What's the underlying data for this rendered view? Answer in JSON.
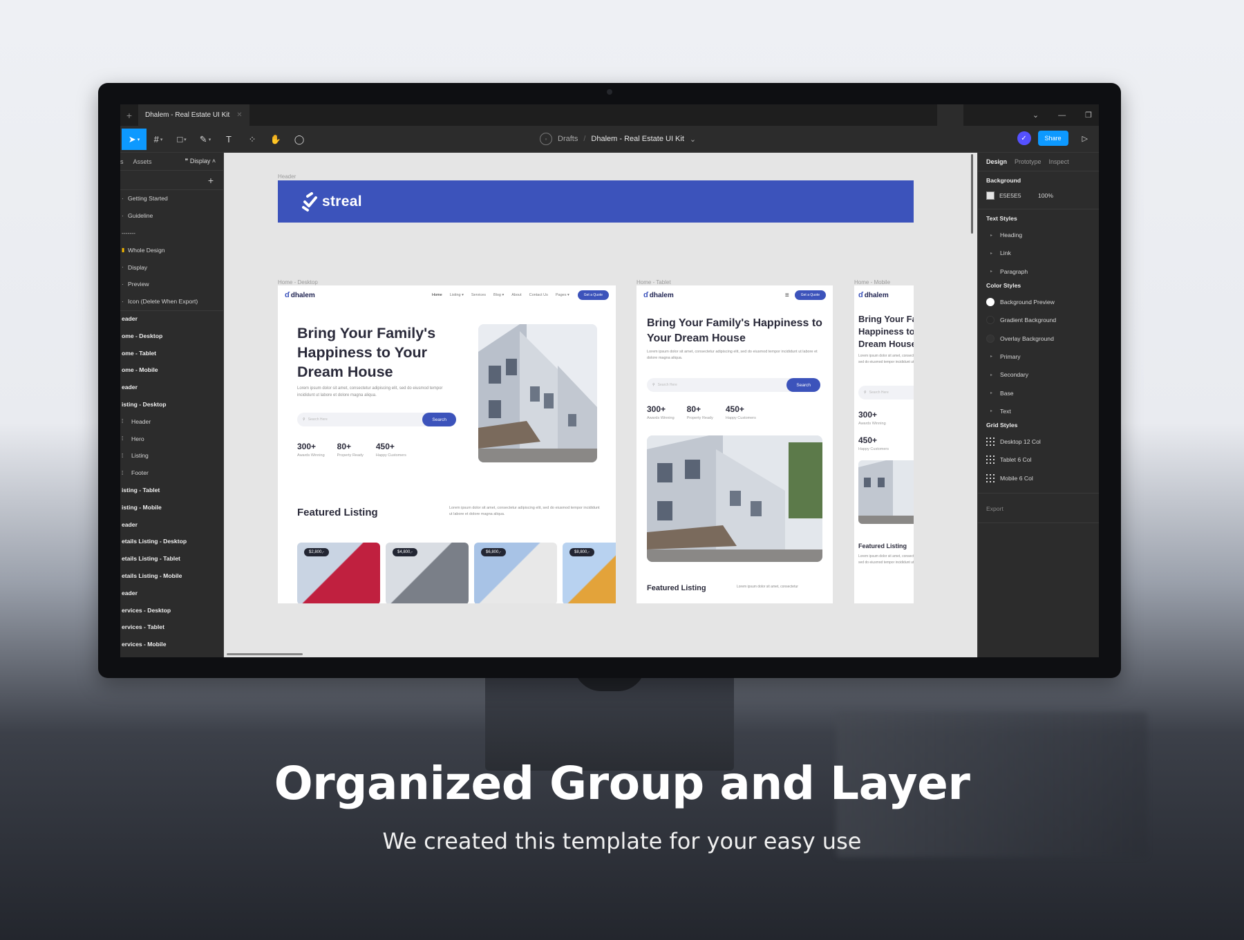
{
  "window": {
    "tab_title": "Dhalem - Real Estate UI Kit"
  },
  "toolbar": {
    "crumb_root": "Drafts",
    "crumb_sep": "/",
    "file_name": "Dhalem - Real Estate UI Kit",
    "share": "Share"
  },
  "left_panel": {
    "tabs": [
      "s",
      "Assets",
      "Display"
    ],
    "layers": [
      {
        "label": "Getting Started",
        "icon": "·",
        "bold": false
      },
      {
        "label": "Guideline",
        "icon": "·",
        "bold": false
      },
      {
        "label": "-------",
        "icon": "",
        "bold": false
      },
      {
        "label": "Whole Design",
        "icon": "▮",
        "bold": false
      },
      {
        "label": "Display",
        "icon": "·",
        "bold": false
      },
      {
        "label": "Preview",
        "icon": "·",
        "bold": false
      },
      {
        "label": "Icon (Delete When Export)",
        "icon": "·",
        "bold": false
      },
      {
        "label": "eader",
        "icon": "",
        "bold": true
      },
      {
        "label": "ome - Desktop",
        "icon": "",
        "bold": true
      },
      {
        "label": "ome - Tablet",
        "icon": "",
        "bold": true
      },
      {
        "label": "ome - Mobile",
        "icon": "",
        "bold": true
      },
      {
        "label": "eader",
        "icon": "",
        "bold": true
      },
      {
        "label": "isting - Desktop",
        "icon": "",
        "bold": true
      },
      {
        "label": "Header",
        "icon": "",
        "bold": false,
        "indent": true
      },
      {
        "label": "Hero",
        "icon": "",
        "bold": false,
        "indent": true
      },
      {
        "label": "Listing",
        "icon": "",
        "bold": false,
        "indent": true
      },
      {
        "label": "Footer",
        "icon": "",
        "bold": false,
        "indent": true
      },
      {
        "label": "isting - Tablet",
        "icon": "",
        "bold": true
      },
      {
        "label": "isting - Mobile",
        "icon": "",
        "bold": true
      },
      {
        "label": "eader",
        "icon": "",
        "bold": true
      },
      {
        "label": "etails Listing - Desktop",
        "icon": "",
        "bold": true
      },
      {
        "label": "etails Listing - Tablet",
        "icon": "",
        "bold": true
      },
      {
        "label": "etails Listing - Mobile",
        "icon": "",
        "bold": true
      },
      {
        "label": "eader",
        "icon": "",
        "bold": true
      },
      {
        "label": "ervices - Desktop",
        "icon": "",
        "bold": true
      },
      {
        "label": "ervices - Tablet",
        "icon": "",
        "bold": true
      },
      {
        "label": "ervices - Mobile",
        "icon": "",
        "bold": true
      }
    ]
  },
  "canvas": {
    "header_label": "Header",
    "brand": "streal",
    "desktop": {
      "frame_label": "Home - Desktop",
      "brand": "dhalem",
      "nav": [
        "Home",
        "Listing ▾",
        "Services",
        "Blog ▾",
        "About",
        "Contact Us",
        "Pages ▾"
      ],
      "quote": "Get a Quote",
      "title": "Bring Your Family's Happiness to Your Dream House",
      "para": "Lorem ipsum dolor sit amet, consectetur adipiscing elit, sed do eiusmod tempor incididunt ut labore et dolore magna aliqua.",
      "search_placeholder": "Search Here",
      "search_btn": "Search",
      "stats": [
        {
          "n": "300+",
          "l": "Awards Winning"
        },
        {
          "n": "80+",
          "l": "Property Ready"
        },
        {
          "n": "450+",
          "l": "Happy Customers"
        }
      ],
      "featured": "Featured Listing",
      "featured_para": "Lorem ipsum dolor sit amet, consectetur adipiscing elit, sed do eiusmod tempor incididunt ut labore et dolore magna aliqua.",
      "prices": [
        "$2,800,-",
        "$4,800,-",
        "$6,800,-",
        "$8,800,-"
      ]
    },
    "tablet": {
      "frame_label": "Home - Tablet",
      "brand": "dhalem",
      "quote": "Get a Quote",
      "title": "Bring Your Family's Happiness to Your Dream House",
      "para": "Lorem ipsum dolor sit amet, consectetur adipiscing elit, sed do eiusmod tempor incididunt ut labore et dolore magna aliqua.",
      "search_placeholder": "Search Here",
      "search_btn": "Search",
      "stats": [
        {
          "n": "300+",
          "l": "Awards Winning"
        },
        {
          "n": "80+",
          "l": "Property Ready"
        },
        {
          "n": "450+",
          "l": "Happy Customers"
        }
      ],
      "featured": "Featured Listing",
      "featured_para": "Lorem ipsum dolor sit amet, consectetur"
    },
    "mobile": {
      "frame_label": "Home - Mobile",
      "brand": "dhalem",
      "title": "Bring Your Family's Happiness to Your Dream House",
      "para": "Lorem ipsum dolor sit amet, consectetur adipiscing elit, sed do eiusmod tempor incididunt ut labore et dolore",
      "search_placeholder": "Search Here",
      "stats": [
        {
          "n": "300+",
          "l": "Awards Winning"
        },
        {
          "n": "450+",
          "l": "Happy Customers"
        }
      ],
      "featured": "Featured Listing",
      "featured_para": "Lorem ipsum dolor sit amet, consectetur adipiscing elit, sed do eiusmod tempor incididunt ut labore et dolore"
    }
  },
  "right_panel": {
    "tabs": [
      "Design",
      "Prototype",
      "Inspect"
    ],
    "background_title": "Background",
    "bg_hex": "E5E5E5",
    "bg_opacity": "100%",
    "text_styles_title": "Text Styles",
    "text_styles": [
      "Heading",
      "Link",
      "Paragraph"
    ],
    "color_styles_title": "Color Styles",
    "color_styles": [
      {
        "label": "Background Preview",
        "color": "#ffffff",
        "caret": false
      },
      {
        "label": "Gradient Background",
        "color": "#2a2a2a",
        "caret": false
      },
      {
        "label": "Overlay Background",
        "color": "#333333",
        "caret": false
      },
      {
        "label": "Primary",
        "caret": true
      },
      {
        "label": "Secondary",
        "caret": true
      },
      {
        "label": "Base",
        "caret": true
      },
      {
        "label": "Text",
        "caret": true
      }
    ],
    "grid_styles_title": "Grid Styles",
    "grid_styles": [
      "Desktop 12 Col",
      "Tablet 6 Col",
      "Mobile 6 Col"
    ],
    "export": "Export"
  },
  "caption": {
    "headline": "Organized Group and Layer",
    "sub": "We created this template for your easy use"
  },
  "colors": {
    "accent": "#3c53bb",
    "figma_blue": "#0d99ff"
  }
}
